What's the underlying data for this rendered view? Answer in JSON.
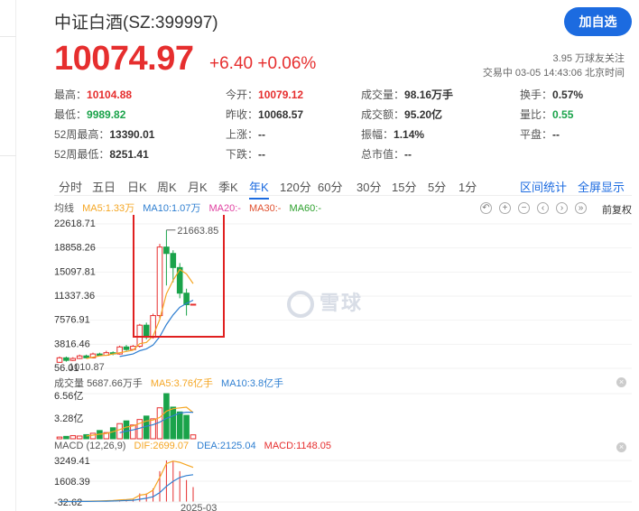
{
  "header": {
    "title": "中证白酒(SZ:399997)",
    "follow_button": "加自选",
    "price": "10074.97",
    "change": "+6.40 +0.06%",
    "followers": "3.95 万球友关注",
    "trade_time": "交易中 03-05 14:43:06 北京时间"
  },
  "stats": [
    {
      "k": "最高：",
      "v": "10104.88",
      "tone": "red"
    },
    {
      "k": "今开：",
      "v": "10079.12",
      "tone": "red"
    },
    {
      "k": "成交量：",
      "v": "98.16万手",
      "tone": ""
    },
    {
      "k": "换手：",
      "v": "0.57%",
      "tone": ""
    },
    {
      "k": "最低：",
      "v": "9989.82",
      "tone": "green"
    },
    {
      "k": "昨收：",
      "v": "10068.57",
      "tone": ""
    },
    {
      "k": "成交额：",
      "v": "95.20亿",
      "tone": ""
    },
    {
      "k": "量比：",
      "v": "0.55",
      "tone": "green"
    },
    {
      "k": "52周最高：",
      "v": "13390.01",
      "tone": ""
    },
    {
      "k": "上涨：",
      "v": "--",
      "tone": ""
    },
    {
      "k": "振幅：",
      "v": "1.14%",
      "tone": ""
    },
    {
      "k": "平盘：",
      "v": "--",
      "tone": ""
    },
    {
      "k": "52周最低：",
      "v": "8251.41",
      "tone": ""
    },
    {
      "k": "下跌：",
      "v": "--",
      "tone": ""
    },
    {
      "k": "总市值：",
      "v": "--",
      "tone": ""
    }
  ],
  "tabs": [
    "分时",
    "五日",
    "日K",
    "周K",
    "月K",
    "季K",
    "年K",
    "120分",
    "60分",
    "30分",
    "15分",
    "5分",
    "1分"
  ],
  "active_tab": "年K",
  "tab_actions": [
    "区间统计",
    "全屏显示"
  ],
  "ma_legend": {
    "avg": "均线",
    "ma5": "MA5:1.33万",
    "ma10": "MA10:1.07万",
    "ma20": "MA20:-",
    "ma30": "MA30:-",
    "ma60": "MA60:-"
  },
  "adjust_label": "前复权",
  "watermark": "雪球",
  "colors": {
    "up": "#e62e2e",
    "down": "#1aa34a",
    "accent": "#1c6be0",
    "ma5": "#f5a623",
    "ma10": "#2f7fd1",
    "ma20": "#e040a0",
    "ma30": "#2ca02c"
  },
  "chart_data": [
    {
      "type": "candlestick",
      "ylabels": [
        "22618.71",
        "18858.26",
        "15097.81",
        "11337.36",
        "7576.91",
        "3816.46",
        "56.01"
      ],
      "max_annotation": "21663.85",
      "min_annotation": "1010.87",
      "x_tick": "2025-03",
      "candles": [
        {
          "o": 1000,
          "c": 1700,
          "h": 1900,
          "l": 900
        },
        {
          "o": 1700,
          "c": 1300,
          "h": 1900,
          "l": 1100
        },
        {
          "o": 1300,
          "c": 1600,
          "h": 1800,
          "l": 1200
        },
        {
          "o": 1600,
          "c": 2000,
          "h": 2200,
          "l": 1500
        },
        {
          "o": 2000,
          "c": 1700,
          "h": 2200,
          "l": 1600
        },
        {
          "o": 1700,
          "c": 2300,
          "h": 2500,
          "l": 1600
        },
        {
          "o": 2300,
          "c": 2100,
          "h": 2500,
          "l": 2000
        },
        {
          "o": 2100,
          "c": 2500,
          "h": 2800,
          "l": 2000
        },
        {
          "o": 2500,
          "c": 2300,
          "h": 2700,
          "l": 2100
        },
        {
          "o": 2300,
          "c": 3400,
          "h": 3600,
          "l": 2200
        },
        {
          "o": 3400,
          "c": 3000,
          "h": 3700,
          "l": 2800
        },
        {
          "o": 3000,
          "c": 3500,
          "h": 3700,
          "l": 2900
        },
        {
          "o": 3500,
          "c": 6800,
          "h": 7000,
          "l": 3300
        },
        {
          "o": 6800,
          "c": 4900,
          "h": 7200,
          "l": 4600
        },
        {
          "o": 4900,
          "c": 8300,
          "h": 8600,
          "l": 4700
        },
        {
          "o": 8300,
          "c": 19000,
          "h": 19500,
          "l": 7900
        },
        {
          "o": 19000,
          "c": 18000,
          "h": 21663.85,
          "l": 13000
        },
        {
          "o": 18000,
          "c": 15800,
          "h": 18500,
          "l": 13500
        },
        {
          "o": 15800,
          "c": 11800,
          "h": 16500,
          "l": 11000
        },
        {
          "o": 11800,
          "c": 10000,
          "h": 12500,
          "l": 8300
        },
        {
          "o": 10068.57,
          "c": 10074.97,
          "h": 10104.88,
          "l": 9989.82
        }
      ],
      "ma5": [
        null,
        null,
        null,
        null,
        1600,
        1800,
        2000,
        2100,
        2300,
        2500,
        2700,
        2900,
        3900,
        4100,
        5100,
        7700,
        11700,
        13800,
        15500,
        14800,
        13300
      ],
      "ma10": [
        null,
        null,
        null,
        null,
        null,
        null,
        null,
        null,
        null,
        1900,
        2100,
        2300,
        2800,
        3100,
        3700,
        5000,
        6900,
        8400,
        9600,
        10200,
        10700
      ]
    },
    {
      "type": "bar",
      "label": "成交量",
      "label_value": "5687.66万手",
      "ma5_label": "MA5:3.76亿手",
      "ma10_label": "MA10:3.8亿手",
      "ylabels": [
        "6.56亿",
        "3.28亿"
      ],
      "values": [
        0.25,
        0.35,
        0.45,
        0.4,
        0.6,
        0.8,
        1.2,
        0.9,
        1.6,
        2.2,
        2.6,
        2.0,
        2.8,
        3.3,
        2.9,
        4.5,
        6.56,
        4.6,
        3.9,
        3.4,
        0.57
      ],
      "up": [
        true,
        false,
        true,
        true,
        false,
        true,
        false,
        true,
        false,
        true,
        false,
        true,
        true,
        false,
        true,
        true,
        false,
        false,
        false,
        false,
        true
      ],
      "ma5": [
        null,
        null,
        null,
        null,
        0.41,
        0.52,
        0.67,
        0.78,
        1.02,
        1.34,
        1.7,
        1.86,
        2.24,
        2.58,
        2.72,
        3.1,
        4.01,
        4.37,
        4.49,
        4.59,
        3.81
      ],
      "ma10": [
        null,
        null,
        null,
        null,
        null,
        null,
        null,
        null,
        null,
        0.88,
        1.12,
        1.29,
        1.53,
        1.82,
        2.05,
        2.42,
        2.96,
        3.33,
        3.74,
        3.86,
        3.86
      ]
    },
    {
      "type": "macd",
      "label": "MACD (12,26,9)",
      "dif_label": "DIF:2699.07",
      "dea_label": "DEA:2125.04",
      "macd_label": "MACD:1148.05",
      "ylabels": [
        "3249.41",
        "1608.39",
        "-32.62"
      ],
      "dif": [
        0,
        5,
        10,
        20,
        25,
        40,
        50,
        70,
        80,
        130,
        160,
        200,
        500,
        580,
        900,
        1900,
        3000,
        3200,
        3100,
        2900,
        2699.07
      ],
      "dea": [
        0,
        2,
        4,
        8,
        12,
        18,
        24,
        34,
        44,
        60,
        80,
        100,
        180,
        260,
        380,
        700,
        1200,
        1600,
        1900,
        2050,
        2125.04
      ],
      "hist": [
        0,
        6,
        12,
        24,
        26,
        44,
        52,
        72,
        72,
        140,
        160,
        200,
        640,
        640,
        1040,
        2400,
        3249.41,
        3200,
        2400,
        1700,
        1148.05
      ]
    }
  ]
}
